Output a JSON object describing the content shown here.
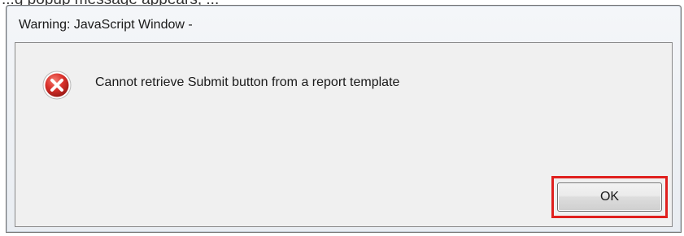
{
  "background_text": "...g popup message appears, ...",
  "dialog": {
    "title": "Warning: JavaScript Window -",
    "icon": "error-icon",
    "message": "Cannot retrieve Submit button from a report template",
    "ok_label": "OK"
  },
  "colors": {
    "error_red": "#d9302b",
    "highlight_red": "#e0201e",
    "window_background": "#f0f0f0"
  }
}
